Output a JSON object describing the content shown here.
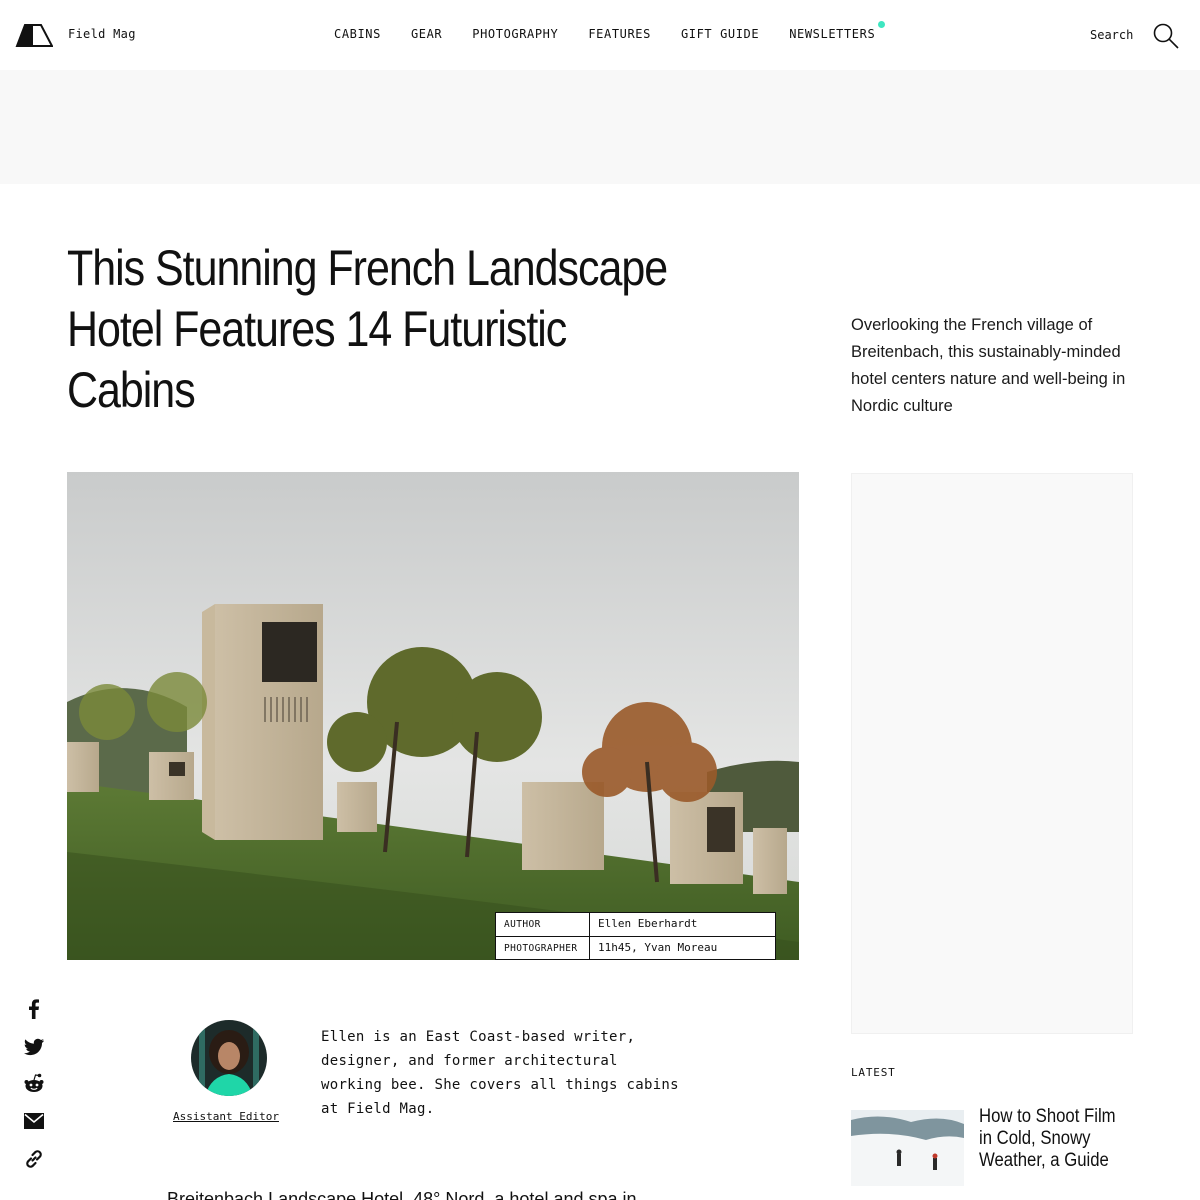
{
  "header": {
    "brand": "Field Mag",
    "nav": [
      "CABINS",
      "GEAR",
      "PHOTOGRAPHY",
      "FEATURES",
      "GIFT GUIDE",
      "NEWSLETTERS"
    ],
    "search_label": "Search"
  },
  "article": {
    "title": "This Stunning French Landscape Hotel Features 14 Futuristic Cabins",
    "deck": "Overlooking the French village of Breitenbach, this sustainably-minded hotel centers nature and well-being in Nordic culture",
    "credits": [
      {
        "key": "AUTHOR",
        "value": "Ellen Eberhardt"
      },
      {
        "key": "PHOTOGRAPHER",
        "value": "11h45, Yvan Moreau"
      }
    ],
    "author": {
      "role": "Assistant Editor",
      "bio": "Ellen is an East Coast-based writer, designer, and former architectural working bee. She covers all things cabins at Field Mag."
    },
    "body_start": "Breitenbach Landscape Hotel, 48° Nord, a hotel and spa in"
  },
  "sidebar": {
    "latest_label": "LATEST",
    "latest_item_title": "How to Shoot Film in Cold, Snowy Weather, a Guide"
  },
  "share": [
    "facebook-icon",
    "twitter-icon",
    "reddit-icon",
    "email-icon",
    "link-icon"
  ],
  "colors": {
    "accent_dot": "#3ee6c1",
    "text": "#111111",
    "ad_band": "#f8f8f8"
  }
}
